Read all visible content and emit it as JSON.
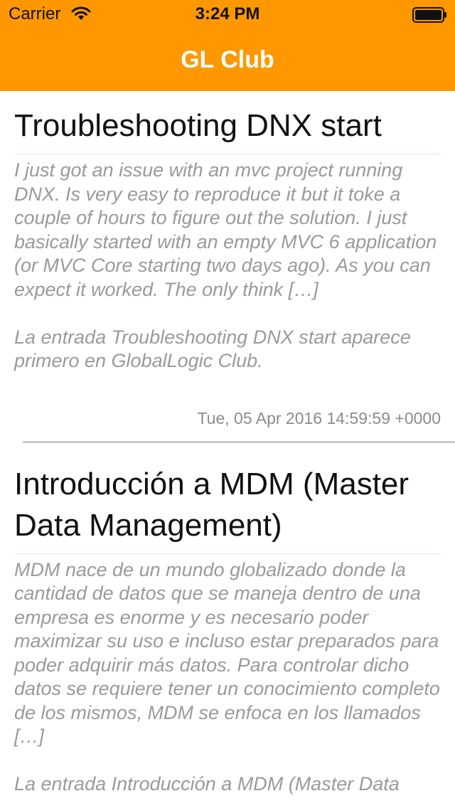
{
  "status_bar": {
    "carrier": "Carrier",
    "time": "3:24 PM",
    "wifi_icon": "wifi-icon",
    "battery_icon": "battery-icon"
  },
  "nav": {
    "title": "GL Club"
  },
  "colors": {
    "accent": "#ff9800",
    "title_text": "#111111",
    "body_text": "#9a9a9a",
    "date_text": "#8c8c8c"
  },
  "posts": [
    {
      "title": "Troubleshooting DNX start",
      "body": "I just got an issue with an mvc project running DNX. Is very easy to reproduce it but it toke a couple of hours to figure out the solution. I just basically started with an empty MVC 6 application (or MVC Core starting two days ago). As you can expect it worked. The only think […]\n\nLa entrada Troubleshooting DNX start aparece primero en GlobalLogic Club.",
      "date": "Tue, 05 Apr 2016 14:59:59 +0000"
    },
    {
      "title": "Introducción a MDM (Master Data Management)",
      "body": "MDM nace de un mundo globalizado donde la cantidad de datos que se maneja dentro de una empresa es enorme y es necesario poder maximizar su uso e incluso estar preparados para poder adquirir más datos. Para controlar dicho datos se requiere tener un conocimiento completo de los mismos, MDM se enfoca en los llamados […]\n\nLa entrada Introducción a MDM (Master Data",
      "date": ""
    }
  ]
}
